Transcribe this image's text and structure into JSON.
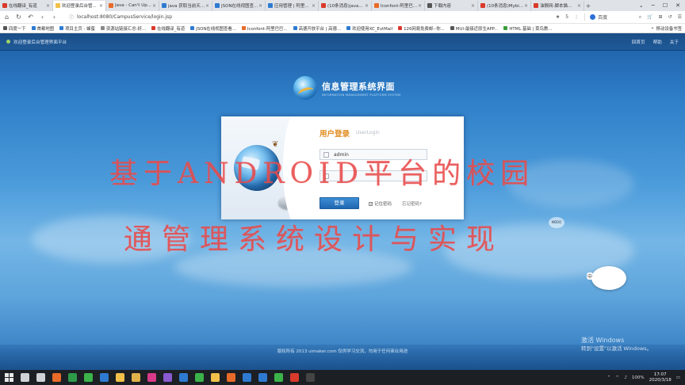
{
  "browser": {
    "tabs": [
      {
        "label": "在线翻译_有道",
        "color": "#d93a2b",
        "active": false
      },
      {
        "label": "欢迎登录后台管...",
        "color": "#f1c14a",
        "active": true
      },
      {
        "label": "Java - Can't Up...",
        "color": "#e86b2a",
        "active": false
      },
      {
        "label": "java 获取当前天...",
        "color": "#2e7ad1",
        "active": false
      },
      {
        "label": "JSON在线视图查...",
        "color": "#2e7ad1",
        "active": false
      },
      {
        "label": "应用管理 | 阿里...",
        "color": "#2e7ad1",
        "active": false
      },
      {
        "label": "(10条消息)java...",
        "color": "#d93a2b",
        "active": false
      },
      {
        "label": "Iconfont-阿里巴...",
        "color": "#e86b2a",
        "active": false
      },
      {
        "label": "下载内容",
        "color": "#555555",
        "active": false
      },
      {
        "label": "(10条消息)Mybi...",
        "color": "#d93a2b",
        "active": false
      },
      {
        "label": "油猴网-脚本猫...",
        "color": "#d93a2b",
        "active": false
      }
    ],
    "new_tab": "+",
    "window_controls": [
      "⌄",
      "─",
      "☐",
      "✕"
    ],
    "url": "localhost:8080/CampusService/login.jsp",
    "search_engine": "百度",
    "star_count": "5",
    "bookmarks": [
      {
        "label": "四度一下",
        "color": "#555555"
      },
      {
        "label": "首都地图",
        "color": "#2e7ad1"
      },
      {
        "label": "项目主页 - 蜂蜜",
        "color": "#2e7ad1"
      },
      {
        "label": "资源站链接汇总-好...",
        "color": "#888888"
      },
      {
        "label": "在线翻译_有道",
        "color": "#d93a2b"
      },
      {
        "label": "JSON在线视图查看...",
        "color": "#2e7ad1"
      },
      {
        "label": "Iconfont-阿里巴巴...",
        "color": "#e86b2a"
      },
      {
        "label": "高德开放平台 | 高德...",
        "color": "#2e7ad1"
      },
      {
        "label": "欢迎使用XC_EvtMail",
        "color": "#2e7ad1"
      },
      {
        "label": "126网易免费邮--你...",
        "color": "#d93a2b"
      },
      {
        "label": "MUI-最接近原生APP...",
        "color": "#555555"
      },
      {
        "label": "HTML 基础 | 菜鸟教...",
        "color": "#3a9c3a"
      }
    ],
    "bookmarks_more": "»",
    "mobile_bookmarks": "移动设备书签"
  },
  "site": {
    "welcome": "欢迎登录后台管理界面平台",
    "top_links": [
      "回首页",
      "帮助",
      "关于"
    ],
    "logo_title": "信息管理系统界面",
    "logo_subtitle": "INFORMATION MANAGEMENT PLATFORM SYSTEM"
  },
  "login": {
    "title": "用户登录",
    "subtitle": "UserLogin",
    "username_value": "admin",
    "password_value": "",
    "submit_label": "登录",
    "remember_label": "记住密码",
    "remember_checked": true,
    "forgot_label": "忘记密码?"
  },
  "overlay": {
    "line1": "基于ANDROID平台的校园",
    "line2": "通管理系统设计与实现"
  },
  "mascot_tag": "中",
  "bubble_text": "MBOO",
  "watermark": {
    "title": "激活 Windows",
    "sub": "转到\"设置\"以激活 Windows。"
  },
  "copyright": "版权所有 2013 uimaker.com 仅供学习交流，勿用于任何商业用途",
  "taskbar": {
    "time": "17:07",
    "date": "2020/3/18",
    "battery": "100%",
    "apps": [
      {
        "name": "search-app-icon",
        "color": "#cfd3d8"
      },
      {
        "name": "task-view-icon",
        "color": "#cfd3d8"
      },
      {
        "name": "firefox-icon",
        "color": "#e86b2a"
      },
      {
        "name": "chrome-icon",
        "color": "#2e9b4a"
      },
      {
        "name": "wechat-icon",
        "color": "#3cb34a"
      },
      {
        "name": "qq-icon",
        "color": "#2e7ad1"
      },
      {
        "name": "explorer-icon",
        "color": "#f1c14a"
      },
      {
        "name": "photos-icon",
        "color": "#e0b24a"
      },
      {
        "name": "ide-icon",
        "color": "#d93a8a"
      },
      {
        "name": "idea-icon",
        "color": "#8a5ad1"
      },
      {
        "name": "terminal-icon",
        "color": "#2e7ad1"
      },
      {
        "name": "android-studio-icon",
        "color": "#3cb34a"
      },
      {
        "name": "notes-icon",
        "color": "#f1c14a"
      },
      {
        "name": "sublime-icon",
        "color": "#e86b2a"
      },
      {
        "name": "vscode-icon",
        "color": "#2e7ad1"
      },
      {
        "name": "music-icon",
        "color": "#2e7ad1"
      },
      {
        "name": "evernote-icon",
        "color": "#3cb34a"
      },
      {
        "name": "tool-icon",
        "color": "#d93a2b"
      },
      {
        "name": "cmd-icon",
        "color": "#444444"
      }
    ]
  }
}
